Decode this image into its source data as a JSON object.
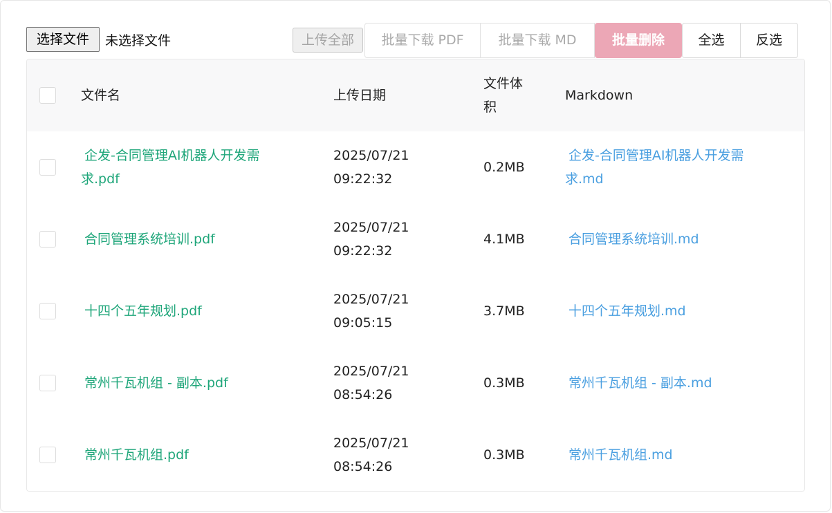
{
  "file_input": {
    "button_label": "选择文件",
    "status": "未选择文件"
  },
  "toolbar": {
    "upload_all": "上传全部",
    "download_pdf": "批量下载 PDF",
    "download_md": "批量下载 MD",
    "delete": "批量删除",
    "select_all": "全选",
    "invert": "反选"
  },
  "colors": {
    "pdf_link": "#1fa67a",
    "md_link": "#4a9fe0",
    "delete_button": "#eca7b6"
  },
  "table": {
    "headers": {
      "filename": "文件名",
      "upload_date": "上传日期",
      "size_line1": "文件体",
      "size_line2": "积",
      "markdown": "Markdown"
    },
    "rows": [
      {
        "pdf_line1": "企发-合同管理AI机器人开发需",
        "pdf_line2": "求.pdf",
        "date": "2025/07/21",
        "time": "09:22:32",
        "size": "0.2MB",
        "md_line1": "企发-合同管理AI机器人开发需",
        "md_line2": "求.md"
      },
      {
        "pdf": "合同管理系统培训.pdf",
        "date": "2025/07/21",
        "time": "09:22:32",
        "size": "4.1MB",
        "md": "合同管理系统培训.md"
      },
      {
        "pdf": "十四个五年规划.pdf",
        "date": "2025/07/21",
        "time": "09:05:15",
        "size": "3.7MB",
        "md": "十四个五年规划.md"
      },
      {
        "pdf": "常州千瓦机组 - 副本.pdf",
        "date": "2025/07/21",
        "time": "08:54:26",
        "size": "0.3MB",
        "md": "常州千瓦机组 - 副本.md"
      },
      {
        "pdf": "常州千瓦机组.pdf",
        "date": "2025/07/21",
        "time": "08:54:26",
        "size": "0.3MB",
        "md": "常州千瓦机组.md"
      }
    ]
  }
}
